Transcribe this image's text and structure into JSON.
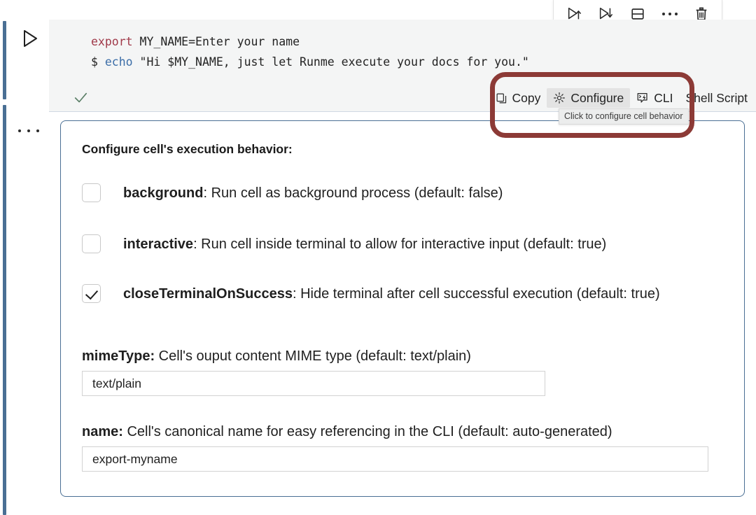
{
  "gutter": {
    "run_icon": "play-triangle-icon",
    "more_icon": "ellipsis-icon"
  },
  "cell_toolbar": {
    "buttons": [
      {
        "name": "run-above-button",
        "icon": "play-up-arrow-icon",
        "label": "Run Above"
      },
      {
        "name": "run-below-button",
        "icon": "play-down-arrow-icon",
        "label": "Run Below"
      },
      {
        "name": "split-cell-button",
        "icon": "split-panel-icon",
        "label": "Split Cell"
      },
      {
        "name": "more-actions-button",
        "icon": "ellipsis-icon",
        "label": "More Actions"
      },
      {
        "name": "delete-cell-button",
        "icon": "trash-icon",
        "label": "Delete Cell"
      }
    ]
  },
  "code": {
    "line1": {
      "keyword": "export",
      "rest": " MY_NAME=Enter your name"
    },
    "line2": {
      "prompt": "$ ",
      "command": "echo",
      "rest": " \"Hi $MY_NAME, just let Runme execute your docs for you.\""
    }
  },
  "statusbar": {
    "success_icon": "green-checkmark-icon",
    "copy_label": "Copy",
    "copy_icon": "copy-icon",
    "configure_label": "Configure",
    "configure_icon": "gear-icon",
    "cli_label": "CLI",
    "cli_icon": "cli-terminal-icon",
    "language_label": "Shell Script"
  },
  "tooltip": {
    "text": "Click to configure cell behavior"
  },
  "panel": {
    "title": "Configure cell's execution behavior:",
    "options": [
      {
        "key": "background",
        "checked": false,
        "name_text": "background",
        "description": ": Run cell as background process (default: false)"
      },
      {
        "key": "interactive",
        "checked": false,
        "name_text": "interactive",
        "description": ": Run cell inside terminal to allow for interactive input (default: true)"
      },
      {
        "key": "closeTerminalOnSuccess",
        "checked": true,
        "name_text": "closeTerminalOnSuccess",
        "description": ": Hide terminal after cell successful execution (default: true)"
      }
    ],
    "fields": [
      {
        "key": "mimeType",
        "name_text": "mimeType:",
        "description": " Cell's ouput content MIME type (default: text/plain)",
        "value": "text/plain",
        "placeholder": "text/plain"
      },
      {
        "key": "name",
        "name_text": "name:",
        "description": " Cell's canonical name for easy referencing in the CLI (default: auto-generated)",
        "value": "export-myname",
        "placeholder": "auto-generated"
      }
    ]
  },
  "annotation": {
    "color": "#8c3a36",
    "target": "configure-button"
  },
  "colors": {
    "gutter_bar": "#4a6f94",
    "code_bg": "#f4f5f5",
    "panel_border": "#4a6f94",
    "keyword": "#a03a4a",
    "function": "#3c6ea8",
    "check_green": "#4c7f5c",
    "active_bg": "#e3e3e3"
  }
}
